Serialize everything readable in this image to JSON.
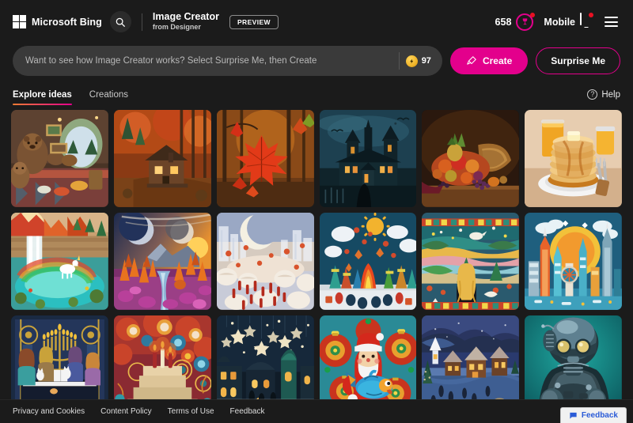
{
  "header": {
    "brand_name": "Microsoft Bing",
    "search_icon": "search-icon",
    "app_title": "Image Creator",
    "app_subtitle": "from Designer",
    "preview_label": "PREVIEW",
    "rewards_count": "658",
    "rewards_icon": "rewards-trophy-icon",
    "mobile_label": "Mobile",
    "mobile_icon": "mobile-phone-icon",
    "menu_icon": "hamburger-menu-icon"
  },
  "prompt": {
    "value": "",
    "placeholder": "Want to see how Image Creator works? Select Surprise Me, then Create",
    "boost_count": "97",
    "boost_icon": "lightning-bolt-icon",
    "create_label": "Create",
    "create_icon": "magic-brush-icon",
    "surprise_label": "Surprise Me"
  },
  "tabs": [
    {
      "label": "Explore ideas",
      "active": true
    },
    {
      "label": "Creations",
      "active": false
    }
  ],
  "help": {
    "label": "Help",
    "icon": "question-mark-icon",
    "glyph": "?"
  },
  "colors": {
    "accent_pink": "#e3008c",
    "accent_orange": "#f07c33",
    "background": "#1b1b1b",
    "field": "#3a3a3a",
    "notification_red": "#e81123",
    "feedback_blue": "#2a5bd7"
  },
  "gallery": {
    "tiles": [
      {
        "id": 1,
        "alt": "Brown bears feasting inside a cozy cave den"
      },
      {
        "id": 2,
        "alt": "Wooden cabin in a fiery autumn forest"
      },
      {
        "id": 3,
        "alt": "Red maple leaves in a sunlit forest"
      },
      {
        "id": 4,
        "alt": "Gothic haunted mansion under stormy sky"
      },
      {
        "id": 5,
        "alt": "Cornucopia overflowing with autumn fruit"
      },
      {
        "id": 6,
        "alt": "Stack of pancakes with butter and orange juice"
      },
      {
        "id": 7,
        "alt": "Waterfall with rainbow and white unicorn"
      },
      {
        "id": 8,
        "alt": "Alien valley with twin moons and orange trees"
      },
      {
        "id": 9,
        "alt": "Crescent moon over a crowd in a dreamy city"
      },
      {
        "id": 10,
        "alt": "Felt-craft bonfire gathering with sun and clouds"
      },
      {
        "id": 11,
        "alt": "Blonde woman viewing a quilted landscape"
      },
      {
        "id": 12,
        "alt": "Papercraft futuristic city skyline at sunset"
      },
      {
        "id": 13,
        "alt": "Women at a piano with menorah and cats"
      },
      {
        "id": 14,
        "alt": "Ornate psychedelic temple with candles"
      },
      {
        "id": 15,
        "alt": "Night city with hanging star ornaments"
      },
      {
        "id": 16,
        "alt": "Santa figurine holding a colorful fish"
      },
      {
        "id": 17,
        "alt": "Snowy village with people ice skating at dusk"
      },
      {
        "id": 18,
        "alt": "Retro chrome robot with glowing eyes"
      }
    ]
  },
  "footer": {
    "links": [
      {
        "label": "Privacy and Cookies"
      },
      {
        "label": "Content Policy"
      },
      {
        "label": "Terms of Use"
      },
      {
        "label": "Feedback"
      }
    ],
    "feedback_widget_label": "Feedback",
    "feedback_widget_icon": "speech-bubble-icon"
  }
}
